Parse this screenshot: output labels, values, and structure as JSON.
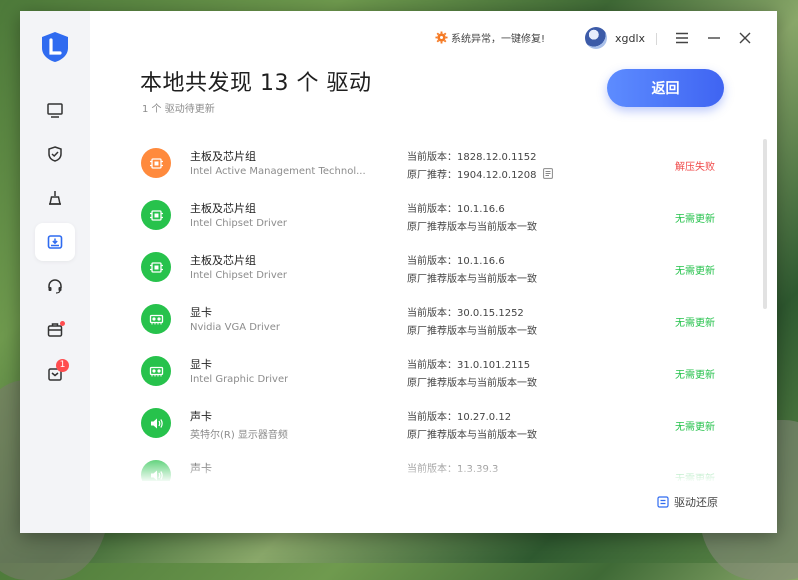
{
  "app": {
    "warning_text": "系统异常，一键修复!",
    "username": "xgdlx"
  },
  "header": {
    "title": "本地共发现 13 个 驱动",
    "subtitle": "1 个 驱动待更新",
    "back_label": "返回"
  },
  "sidebar": {
    "items": [
      {
        "icon": "monitor-icon"
      },
      {
        "icon": "shield-icon"
      },
      {
        "icon": "broom-icon"
      },
      {
        "icon": "driver-icon",
        "active": true
      },
      {
        "icon": "headset-icon"
      },
      {
        "icon": "toolbox-icon",
        "dot": true
      },
      {
        "icon": "message-icon",
        "badge": "1"
      }
    ]
  },
  "drivers": [
    {
      "name": "主板及芯片组",
      "desc": "Intel Active Management Technol...",
      "current": "当前版本：1828.12.0.1152",
      "recommend": "原厂推荐：1904.12.0.1208",
      "has_doc": true,
      "status": "解压失败",
      "status_type": "fail",
      "icon_color": "#ff8a3d",
      "icon": "chip-icon"
    },
    {
      "name": "主板及芯片组",
      "desc": "Intel Chipset Driver",
      "current": "当前版本：10.1.16.6",
      "recommend": "原厂推荐版本与当前版本一致",
      "status": "无需更新",
      "status_type": "ok",
      "icon_color": "#27c24c",
      "icon": "chip-icon"
    },
    {
      "name": "主板及芯片组",
      "desc": "Intel Chipset Driver",
      "current": "当前版本：10.1.16.6",
      "recommend": "原厂推荐版本与当前版本一致",
      "status": "无需更新",
      "status_type": "ok",
      "icon_color": "#27c24c",
      "icon": "chip-icon"
    },
    {
      "name": "显卡",
      "desc": "Nvidia VGA Driver",
      "current": "当前版本：30.0.15.1252",
      "recommend": "原厂推荐版本与当前版本一致",
      "status": "无需更新",
      "status_type": "ok",
      "icon_color": "#27c24c",
      "icon": "gpu-icon"
    },
    {
      "name": "显卡",
      "desc": "Intel Graphic Driver",
      "current": "当前版本：31.0.101.2115",
      "recommend": "原厂推荐版本与当前版本一致",
      "status": "无需更新",
      "status_type": "ok",
      "icon_color": "#27c24c",
      "icon": "gpu-icon"
    },
    {
      "name": "声卡",
      "desc": "英特尔(R) 显示器音频",
      "current": "当前版本：10.27.0.12",
      "recommend": "原厂推荐版本与当前版本一致",
      "status": "无需更新",
      "status_type": "ok",
      "icon_color": "#27c24c",
      "icon": "speaker-icon"
    },
    {
      "name": "声卡",
      "desc": "",
      "current": "当前版本：1.3.39.3",
      "recommend": "",
      "status": "无需更新",
      "status_type": "ok",
      "icon_color": "#27c24c",
      "icon": "speaker-icon"
    }
  ],
  "footer": {
    "restore_label": "驱动还原"
  },
  "colors": {
    "accent": "#4a72f5",
    "ok": "#23c14a",
    "fail": "#f04848"
  }
}
